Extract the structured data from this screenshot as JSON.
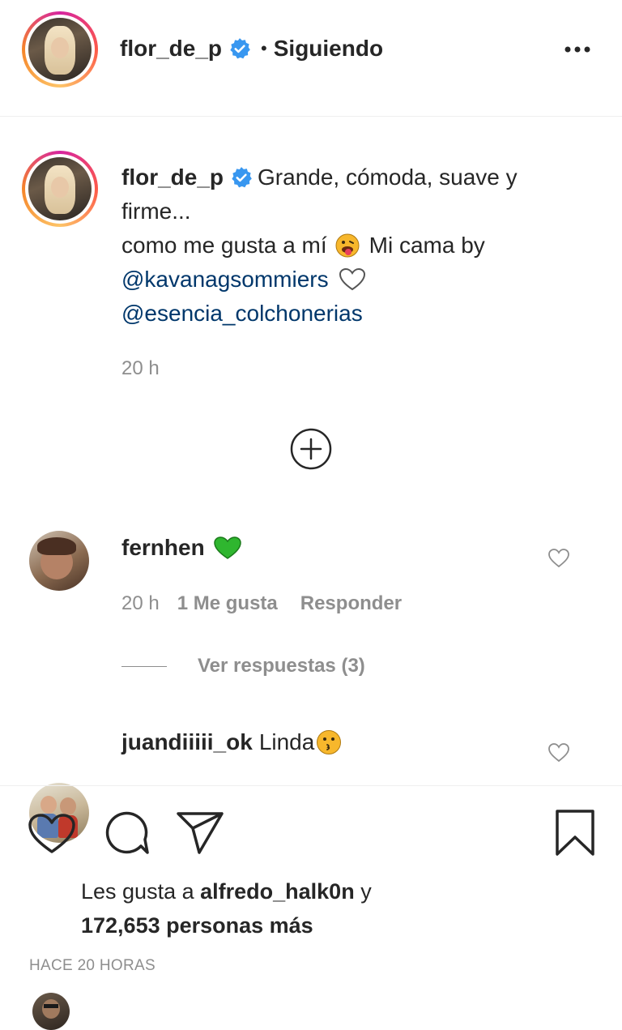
{
  "header": {
    "username": "flor_de_p",
    "separator": "•",
    "follow_status": "Siguiendo",
    "more_icon": "more-horizontal-icon"
  },
  "caption": {
    "username": "flor_de_p",
    "line1": "Grande, cómoda, suave y",
    "line2": "firme...",
    "line3a": "como me gusta a mí",
    "line3b": "Mi cama by",
    "mention1": "@kavanagsommiers",
    "mention2": "@esencia_colchonerias",
    "time": "20 h"
  },
  "load_more_icon": "plus-circle-icon",
  "comments": [
    {
      "username": "fernhen",
      "time": "20 h",
      "likes": "1 Me gusta",
      "reply": "Responder",
      "view_replies": "Ver respuestas (3)"
    },
    {
      "username": "juandiiiii_ok",
      "text": "Linda"
    }
  ],
  "actions": {
    "like_icon": "heart-icon",
    "comment_icon": "comment-icon",
    "share_icon": "paper-plane-icon",
    "save_icon": "bookmark-icon"
  },
  "likes": {
    "prefix": "Les gusta a",
    "user": "alfredo_halk0n",
    "conj": "y",
    "count_text": "172,653 personas más"
  },
  "timestamp": "HACE 20 HORAS",
  "colors": {
    "verified": "#3897f0",
    "link": "#00376b",
    "muted": "#8e8e8e",
    "green_heart": "#2fb62f"
  }
}
